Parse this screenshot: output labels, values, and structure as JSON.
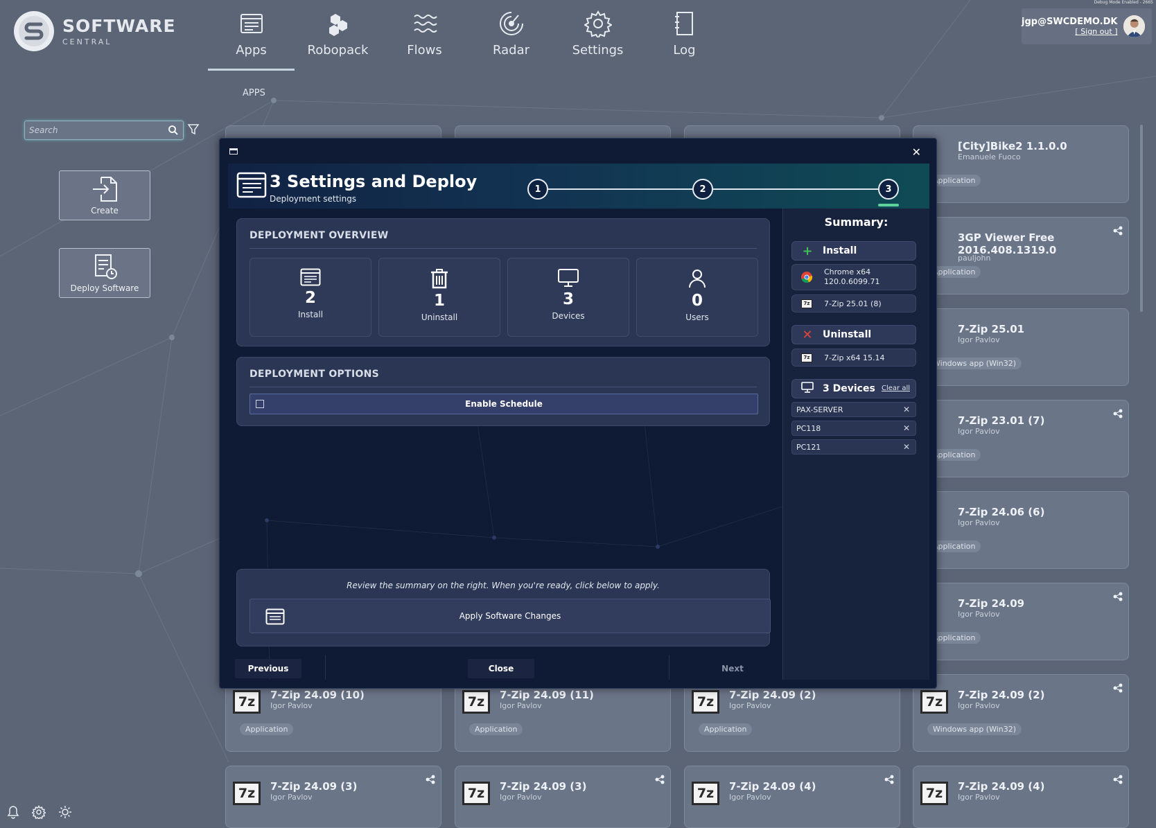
{
  "debug_tag": "Debug Mode Enabled - 2665",
  "logo": {
    "title": "SOFTWARE",
    "subtitle": "CENTRAL"
  },
  "nav": [
    {
      "label": "Apps",
      "icon": "apps-icon",
      "active": true
    },
    {
      "label": "Robopack",
      "icon": "robopack-icon"
    },
    {
      "label": "Flows",
      "icon": "flows-icon"
    },
    {
      "label": "Radar",
      "icon": "radar-icon"
    },
    {
      "label": "Settings",
      "icon": "gear-icon"
    },
    {
      "label": "Log",
      "icon": "log-icon"
    }
  ],
  "user": {
    "email": "jgp@SWCDEMO.DK",
    "sign_out": "[ Sign out ]"
  },
  "section_label": "APPS",
  "search": {
    "placeholder": "Search"
  },
  "sidebar": {
    "create_label": "Create",
    "deploy_label": "Deploy Software"
  },
  "app_cards": [
    {
      "title": "[City]Bike2 1.1.0.0",
      "author": "Emanuele Fuoco",
      "badge": "Application"
    },
    {
      "title": "3GP Viewer Free 2016.408.1319.0",
      "author": "pauljohn",
      "badge": "Application"
    },
    {
      "title": "7-Zip 25.01",
      "author": "Igor Pavlov",
      "badge": "Windows app (Win32)"
    },
    {
      "title": "7-Zip 23.01 (7)",
      "author": "Igor Pavlov",
      "badge": "Application"
    },
    {
      "title": "7-Zip 24.06 (6)",
      "author": "Igor Pavlov",
      "badge": "Application"
    },
    {
      "title": "7-Zip 24.09",
      "author": "Igor Pavlov",
      "badge": "Application"
    },
    {
      "title": "7-Zip 24.09 (2)",
      "author": "Igor Pavlov",
      "badge": "Windows app (Win32)"
    },
    {
      "title": "7-Zip 24.09 (10)",
      "author": "Igor Pavlov",
      "badge": "Application"
    },
    {
      "title": "7-Zip 24.09 (11)",
      "author": "Igor Pavlov",
      "badge": "Application"
    },
    {
      "title": "7-Zip 24.09 (2)",
      "author": "Igor Pavlov",
      "badge": "Application"
    },
    {
      "title": "7-Zip 24.09 (3)",
      "author": "Igor Pavlov",
      "badge": ""
    },
    {
      "title": "7-Zip 24.09 (3)",
      "author": "Igor Pavlov",
      "badge": ""
    },
    {
      "title": "7-Zip 24.09 (4)",
      "author": "Igor Pavlov",
      "badge": ""
    },
    {
      "title": "7-Zip 24.09 (4)",
      "author": "Igor Pavlov",
      "badge": ""
    }
  ],
  "modal": {
    "title": "3 Settings and Deploy",
    "subtitle": "Deployment settings",
    "steps": [
      "1",
      "2",
      "3"
    ],
    "active_step": 3,
    "overview": {
      "title": "DEPLOYMENT OVERVIEW",
      "stats": [
        {
          "value": "2",
          "label": "Install",
          "icon": "apps-icon"
        },
        {
          "value": "1",
          "label": "Uninstall",
          "icon": "trash-icon"
        },
        {
          "value": "3",
          "label": "Devices",
          "icon": "monitor-icon"
        },
        {
          "value": "0",
          "label": "Users",
          "icon": "user-icon"
        }
      ]
    },
    "options": {
      "title": "DEPLOYMENT OPTIONS",
      "schedule_label": "Enable Schedule",
      "schedule_checked": false
    },
    "review_text": "Review the summary on the right. When you're ready, click below to apply.",
    "apply_label": "Apply Software Changes",
    "footer": {
      "previous": "Previous",
      "close": "Close",
      "next": "Next"
    },
    "summary": {
      "title": "Summary:",
      "install_label": "Install",
      "install_items": [
        {
          "name": "Chrome x64 120.0.6099.71",
          "icon": "chrome-icon"
        },
        {
          "name": "7-Zip 25.01 (8)",
          "icon": "7zip-icon"
        }
      ],
      "uninstall_label": "Uninstall",
      "uninstall_items": [
        {
          "name": "7-Zip x64 15.14",
          "icon": "7zip-icon"
        }
      ],
      "devices_label": "3 Devices",
      "clear_all": "Clear all",
      "devices": [
        "PAX-SERVER",
        "PC118",
        "PC121"
      ]
    }
  },
  "colors": {
    "accent_green": "#5fd19b",
    "install_green": "#3fbf55",
    "uninstall_red": "#e2453c"
  }
}
